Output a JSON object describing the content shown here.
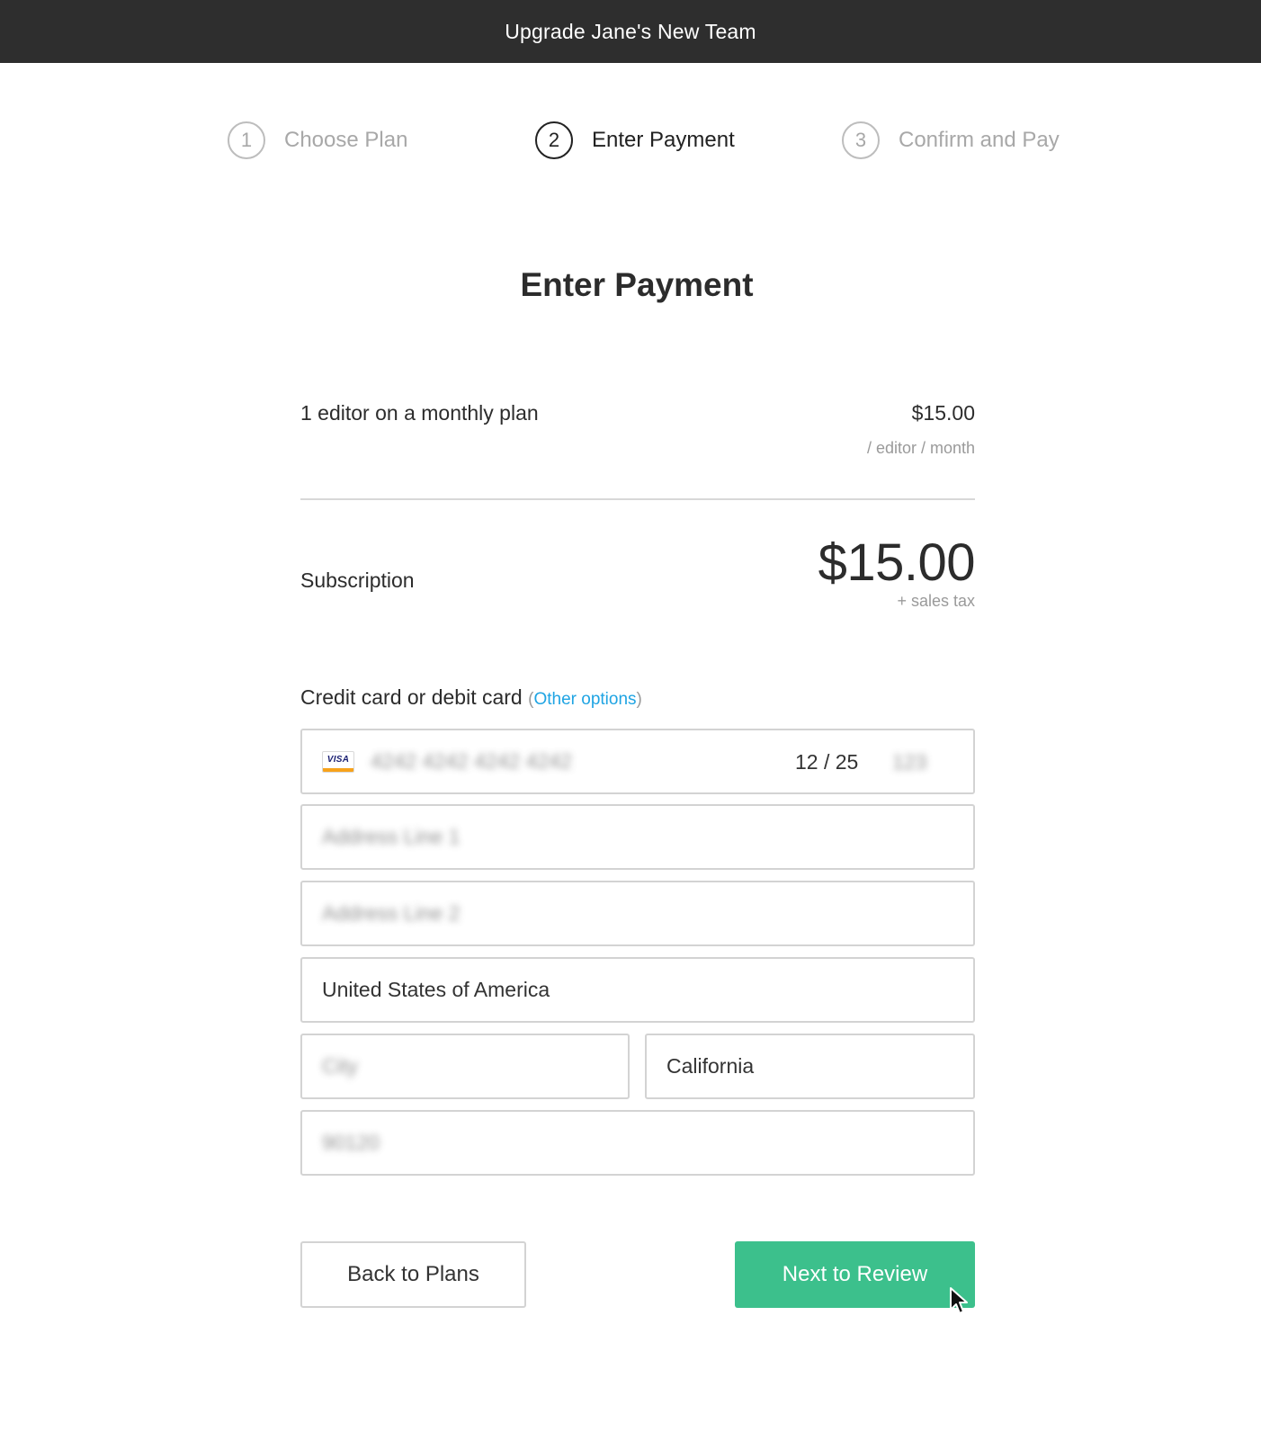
{
  "header": {
    "title": "Upgrade Jane's New Team"
  },
  "steps": [
    {
      "number": "1",
      "label": "Choose Plan",
      "active": false
    },
    {
      "number": "2",
      "label": "Enter Payment",
      "active": true
    },
    {
      "number": "3",
      "label": "Confirm and Pay",
      "active": false
    }
  ],
  "page": {
    "title": "Enter Payment"
  },
  "plan": {
    "description": "1 editor on a monthly plan",
    "price": "$15.00",
    "unit": "/ editor / month"
  },
  "subscription": {
    "label": "Subscription",
    "total": "$15.00",
    "tax_note": "+ sales tax"
  },
  "payment": {
    "heading": "Credit card or debit card",
    "open_paren": "(",
    "other_options": "Other options",
    "close_paren": ")",
    "card_brand_icon": "visa-icon",
    "card_brand_text": "VISA",
    "card_number": "4242 4242 4242 4242",
    "card_expiry": "12 / 25",
    "card_cvc": "123",
    "address_line1": "Address Line 1",
    "address_line2": "Address Line 2",
    "country": "United States of America",
    "city": "City",
    "state": "California",
    "zip": "90120"
  },
  "buttons": {
    "back": "Back to Plans",
    "next": "Next to Review"
  },
  "colors": {
    "topbar": "#2e2e2e",
    "accent_green": "#3cc08c",
    "link_blue": "#1fa4e3"
  }
}
